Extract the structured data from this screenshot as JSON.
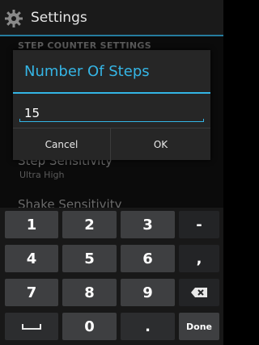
{
  "app": {
    "title": "Settings",
    "icon": "gear-icon"
  },
  "settings": {
    "section_header": "STEP COUNTER SETTINGS",
    "items": [
      {
        "title": "Step Sensitivity",
        "summary": "Ultra High"
      },
      {
        "title": "Shake Sensitivity",
        "summary": ""
      }
    ]
  },
  "dialog": {
    "title": "Number Of Steps",
    "input_value": "15",
    "cancel_label": "Cancel",
    "ok_label": "OK",
    "accent_color": "#33b5e5"
  },
  "keyboard": {
    "keys": [
      "1",
      "2",
      "3",
      "-",
      "4",
      "5",
      "6",
      ",",
      "7",
      "8",
      "9",
      "backspace",
      "space",
      "0",
      ".",
      "Done"
    ],
    "key_1": "1",
    "key_2": "2",
    "key_3": "3",
    "key_dash": "-",
    "key_4": "4",
    "key_5": "5",
    "key_6": "6",
    "key_comma": ",",
    "key_7": "7",
    "key_8": "8",
    "key_9": "9",
    "key_0": "0",
    "key_period": ".",
    "key_done": "Done",
    "backspace_icon": "backspace-icon",
    "space_icon": "space-bar-icon"
  }
}
